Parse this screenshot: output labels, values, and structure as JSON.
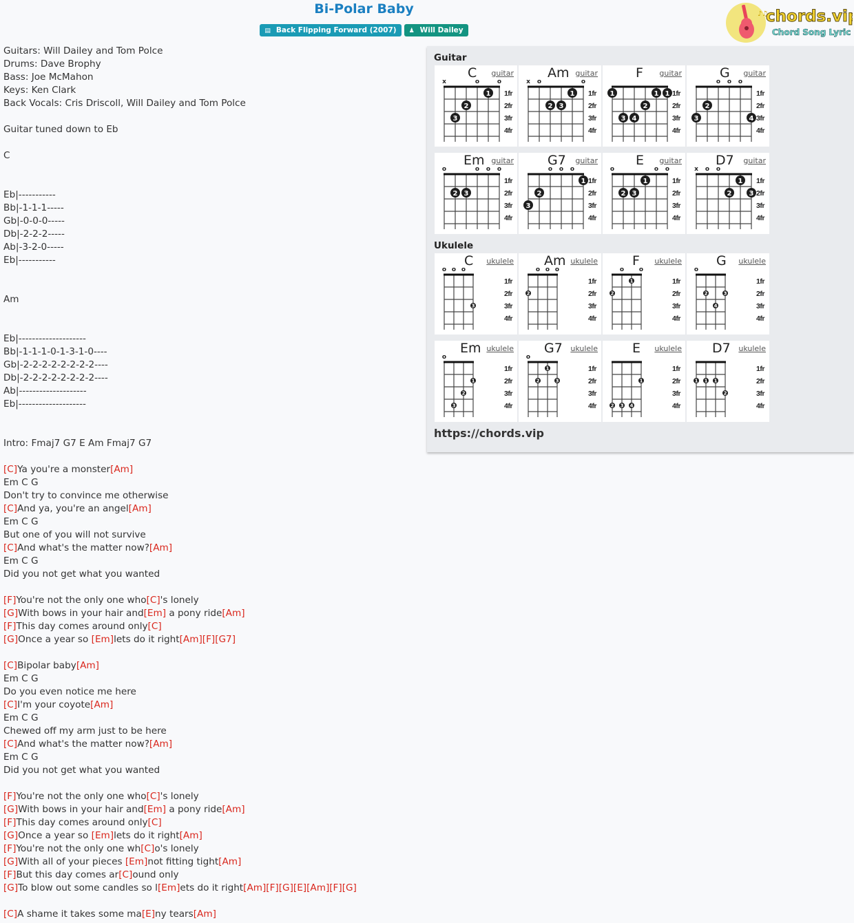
{
  "header": {
    "title": "Bi-Polar Baby",
    "album_badge": "Back Flipping Forward (2007)",
    "artist_badge": "Will Dailey",
    "album_icon": "book-icon",
    "artist_icon": "user-icon"
  },
  "logo": {
    "brand": "chords.vip",
    "tagline": "Chord Song Lyric"
  },
  "lyrics": [
    [
      {
        "t": "Guitars: Will Dailey and Tom Polce"
      }
    ],
    [
      {
        "t": "Drums: Dave Brophy"
      }
    ],
    [
      {
        "t": "Bass: Joe McMahon"
      }
    ],
    [
      {
        "t": "Keys: Ken Clark"
      }
    ],
    [
      {
        "t": "Back Vocals: Cris Driscoll, Will Dailey and Tom Polce"
      }
    ],
    [],
    [
      {
        "t": "Guitar tuned down to Eb"
      }
    ],
    [],
    [
      {
        "t": "C"
      }
    ],
    [],
    [],
    [
      {
        "t": "Eb|-----------"
      }
    ],
    [
      {
        "t": "Bb|-1-1-1-----"
      }
    ],
    [
      {
        "t": "Gb|-0-0-0-----"
      }
    ],
    [
      {
        "t": "Db|-2-2-2-----"
      }
    ],
    [
      {
        "t": "Ab|-3-2-0-----"
      }
    ],
    [
      {
        "t": "Eb|-----------"
      }
    ],
    [],
    [],
    [
      {
        "t": "Am"
      }
    ],
    [],
    [],
    [
      {
        "t": "Eb|--------------------"
      }
    ],
    [
      {
        "t": "Bb|-1-1-1-0-1-3-1-0----"
      }
    ],
    [
      {
        "t": "Gb|-2-2-2-2-2-2-2-2----"
      }
    ],
    [
      {
        "t": "Db|-2-2-2-2-2-2-2-2----"
      }
    ],
    [
      {
        "t": "Ab|--------------------"
      }
    ],
    [
      {
        "t": "Eb|--------------------"
      }
    ],
    [],
    [],
    [
      {
        "t": "Intro: Fmaj7 G7 E Am Fmaj7 G7"
      }
    ],
    [],
    [
      {
        "c": "[C]"
      },
      {
        "t": "Ya you're a monster"
      },
      {
        "c": "[Am]"
      }
    ],
    [
      {
        "t": "Em C G"
      }
    ],
    [
      {
        "t": "Don't try to convince me otherwise"
      }
    ],
    [
      {
        "c": "[C]"
      },
      {
        "t": "And ya, you're an angel"
      },
      {
        "c": "[Am]"
      }
    ],
    [
      {
        "t": "Em C G"
      }
    ],
    [
      {
        "t": "But one of you will not survive"
      }
    ],
    [
      {
        "c": "[C]"
      },
      {
        "t": "And what's the matter now?"
      },
      {
        "c": "[Am]"
      }
    ],
    [
      {
        "t": "Em C G"
      }
    ],
    [
      {
        "t": "Did you not get what you wanted"
      }
    ],
    [],
    [
      {
        "c": "[F]"
      },
      {
        "t": "You're not the only one who"
      },
      {
        "c": "[C]"
      },
      {
        "t": "'s lonely"
      }
    ],
    [
      {
        "c": "[G]"
      },
      {
        "t": "With bows in your hair and"
      },
      {
        "c": "[Em]"
      },
      {
        "t": " a pony ride"
      },
      {
        "c": "[Am]"
      }
    ],
    [
      {
        "c": "[F]"
      },
      {
        "t": "This day comes around only"
      },
      {
        "c": "[C]"
      }
    ],
    [
      {
        "c": "[G]"
      },
      {
        "t": "Once a year so "
      },
      {
        "c": "[Em]"
      },
      {
        "t": "lets do it right"
      },
      {
        "c": "[Am]"
      },
      {
        "c": "[F]"
      },
      {
        "c": "[G7]"
      }
    ],
    [],
    [
      {
        "c": "[C]"
      },
      {
        "t": "Bipolar baby"
      },
      {
        "c": "[Am]"
      }
    ],
    [
      {
        "t": "Em C G"
      }
    ],
    [
      {
        "t": "Do you even notice me here"
      }
    ],
    [
      {
        "c": "[C]"
      },
      {
        "t": "I'm your coyote"
      },
      {
        "c": "[Am]"
      }
    ],
    [
      {
        "t": "Em C G"
      }
    ],
    [
      {
        "t": "Chewed off my arm just to be here"
      }
    ],
    [
      {
        "c": "[C]"
      },
      {
        "t": "And what's the matter now?"
      },
      {
        "c": "[Am]"
      }
    ],
    [
      {
        "t": "Em C G"
      }
    ],
    [
      {
        "t": "Did you not get what you wanted"
      }
    ],
    [],
    [
      {
        "c": "[F]"
      },
      {
        "t": "You're not the only one who"
      },
      {
        "c": "[C]"
      },
      {
        "t": "'s lonely"
      }
    ],
    [
      {
        "c": "[G]"
      },
      {
        "t": "With bows in your hair and"
      },
      {
        "c": "[Em]"
      },
      {
        "t": " a pony ride"
      },
      {
        "c": "[Am]"
      }
    ],
    [
      {
        "c": "[F]"
      },
      {
        "t": "This day comes around only"
      },
      {
        "c": "[C]"
      }
    ],
    [
      {
        "c": "[G]"
      },
      {
        "t": "Once a year so "
      },
      {
        "c": "[Em]"
      },
      {
        "t": "lets do it right"
      },
      {
        "c": "[Am]"
      }
    ],
    [
      {
        "c": "[F]"
      },
      {
        "t": "You're not the only one wh"
      },
      {
        "c": "[C]"
      },
      {
        "t": "o's lonely"
      }
    ],
    [
      {
        "c": "[G]"
      },
      {
        "t": "With all of your pieces "
      },
      {
        "c": "[Em]"
      },
      {
        "t": "not fitting tight"
      },
      {
        "c": "[Am]"
      }
    ],
    [
      {
        "c": "[F]"
      },
      {
        "t": "But this day comes ar"
      },
      {
        "c": "[C]"
      },
      {
        "t": "ound only"
      }
    ],
    [
      {
        "c": "[G]"
      },
      {
        "t": "To blow out some candles so l"
      },
      {
        "c": "[Em]"
      },
      {
        "t": "ets do it right"
      },
      {
        "c": "[Am]"
      },
      {
        "c": "[F]"
      },
      {
        "c": "[G]"
      },
      {
        "c": "[E]"
      },
      {
        "c": "[Am]"
      },
      {
        "c": "[F]"
      },
      {
        "c": "[G]"
      }
    ],
    [],
    [
      {
        "c": "[C]"
      },
      {
        "t": "A shame it takes some ma"
      },
      {
        "c": "[E]"
      },
      {
        "t": "ny tears"
      },
      {
        "c": "[Am]"
      }
    ]
  ],
  "chord_panel": {
    "guitar_label": "Guitar",
    "ukulele_label": "Ukulele",
    "site_url": "https://chords.vip",
    "fret_labels": [
      "1fr",
      "2fr",
      "3fr",
      "4fr"
    ],
    "guitar": [
      {
        "name": "C",
        "link": "guitar",
        "top": [
          "x",
          "",
          "",
          "o",
          "",
          "o"
        ],
        "dots": [
          [
            5,
            1,
            "1"
          ],
          [
            3,
            2,
            "2"
          ],
          [
            2,
            3,
            "3"
          ]
        ]
      },
      {
        "name": "Am",
        "link": "guitar",
        "top": [
          "x",
          "o",
          "",
          "",
          "",
          "o"
        ],
        "dots": [
          [
            5,
            1,
            "1"
          ],
          [
            3,
            2,
            "2"
          ],
          [
            4,
            2,
            "3"
          ]
        ]
      },
      {
        "name": "F",
        "link": "guitar",
        "top": [
          "",
          "",
          "",
          "",
          "",
          ""
        ],
        "dots": [
          [
            1,
            1,
            "1"
          ],
          [
            5,
            1,
            "1"
          ],
          [
            6,
            1,
            "1"
          ],
          [
            4,
            2,
            "2"
          ],
          [
            2,
            3,
            "3"
          ],
          [
            3,
            3,
            "4"
          ]
        ]
      },
      {
        "name": "G",
        "link": "guitar",
        "top": [
          "",
          "",
          "o",
          "o",
          "o",
          ""
        ],
        "dots": [
          [
            2,
            2,
            "2"
          ],
          [
            1,
            3,
            "3"
          ],
          [
            6,
            3,
            "4"
          ]
        ]
      },
      {
        "name": "Em",
        "link": "guitar",
        "top": [
          "o",
          "",
          "",
          "o",
          "o",
          "o"
        ],
        "dots": [
          [
            2,
            2,
            "2"
          ],
          [
            3,
            2,
            "3"
          ]
        ]
      },
      {
        "name": "G7",
        "link": "guitar",
        "top": [
          "",
          "",
          "o",
          "o",
          "o",
          ""
        ],
        "dots": [
          [
            6,
            1,
            "1"
          ],
          [
            2,
            2,
            "2"
          ],
          [
            1,
            3,
            "3"
          ]
        ]
      },
      {
        "name": "E",
        "link": "guitar",
        "top": [
          "o",
          "",
          "",
          "",
          "o",
          "o"
        ],
        "dots": [
          [
            4,
            1,
            "1"
          ],
          [
            2,
            2,
            "2"
          ],
          [
            3,
            2,
            "3"
          ]
        ]
      },
      {
        "name": "D7",
        "link": "guitar",
        "top": [
          "x",
          "o",
          "o",
          "",
          "",
          ""
        ],
        "dots": [
          [
            5,
            1,
            "1"
          ],
          [
            4,
            2,
            "2"
          ],
          [
            6,
            2,
            "3"
          ]
        ]
      }
    ],
    "ukulele": [
      {
        "name": "C",
        "link": "ukulele",
        "top": [
          "o",
          "o",
          "o",
          ""
        ],
        "dots": [
          [
            4,
            3,
            "3"
          ]
        ]
      },
      {
        "name": "Am",
        "link": "ukulele",
        "top": [
          "",
          "o",
          "o",
          "o"
        ],
        "dots": [
          [
            1,
            2,
            "2"
          ]
        ]
      },
      {
        "name": "F",
        "link": "ukulele",
        "top": [
          "",
          "o",
          "",
          "o"
        ],
        "dots": [
          [
            3,
            1,
            "1"
          ],
          [
            1,
            2,
            "2"
          ]
        ]
      },
      {
        "name": "G",
        "link": "ukulele",
        "top": [
          "o",
          "",
          "",
          ""
        ],
        "dots": [
          [
            2,
            2,
            "2"
          ],
          [
            4,
            2,
            "3"
          ],
          [
            3,
            3,
            "4"
          ]
        ]
      },
      {
        "name": "Em",
        "link": "ukulele",
        "top": [
          "o",
          "",
          "",
          ""
        ],
        "dots": [
          [
            4,
            2,
            "1"
          ],
          [
            3,
            3,
            "2"
          ],
          [
            2,
            4,
            "3"
          ]
        ]
      },
      {
        "name": "G7",
        "link": "ukulele",
        "top": [
          "o",
          "",
          "",
          ""
        ],
        "dots": [
          [
            3,
            1,
            "1"
          ],
          [
            2,
            2,
            "2"
          ],
          [
            4,
            2,
            "3"
          ]
        ]
      },
      {
        "name": "E",
        "link": "ukulele",
        "top": [
          "",
          "",
          "",
          ""
        ],
        "dots": [
          [
            4,
            2,
            "1"
          ],
          [
            1,
            4,
            "2"
          ],
          [
            2,
            4,
            "3"
          ],
          [
            3,
            4,
            "4"
          ]
        ]
      },
      {
        "name": "D7",
        "link": "ukulele",
        "top": [
          "",
          "",
          "",
          ""
        ],
        "dots": [
          [
            1,
            2,
            "1"
          ],
          [
            2,
            2,
            "1"
          ],
          [
            3,
            2,
            "1"
          ],
          [
            4,
            3,
            "2"
          ]
        ]
      }
    ]
  }
}
